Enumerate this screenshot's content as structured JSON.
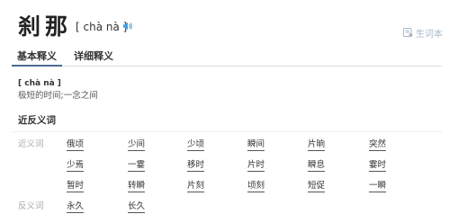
{
  "header": {
    "word": "刹那",
    "pinyin": "[ chà nà ]",
    "vocab_label": "生词本",
    "speaker_icon": "speaker-icon",
    "vocab_icon": "notebook-icon"
  },
  "tabs": [
    {
      "label": "基本释义",
      "active": true
    },
    {
      "label": "详细释义",
      "active": false
    }
  ],
  "definition": {
    "pinyin": "[ chà nà ]",
    "text": "极短的时间;一念之间"
  },
  "related": {
    "title": "近反义词",
    "synonyms_label": "近义词",
    "synonyms": [
      "俄顷",
      "少间",
      "少顷",
      "瞬间",
      "片晌",
      "突然",
      "少焉",
      "一霎",
      "移时",
      "片时",
      "瞬息",
      "霎时",
      "暂时",
      "转瞬",
      "片刻",
      "顷刻",
      "短促",
      "一瞬"
    ],
    "antonyms_label": "反义词",
    "antonyms": [
      "永久",
      "长久"
    ]
  },
  "colors": {
    "tab_active_underline": "#4a6c8f",
    "speaker": "#3ea0e2",
    "vocab": "#a9b9c9",
    "muted_label": "#aaaaaa"
  }
}
